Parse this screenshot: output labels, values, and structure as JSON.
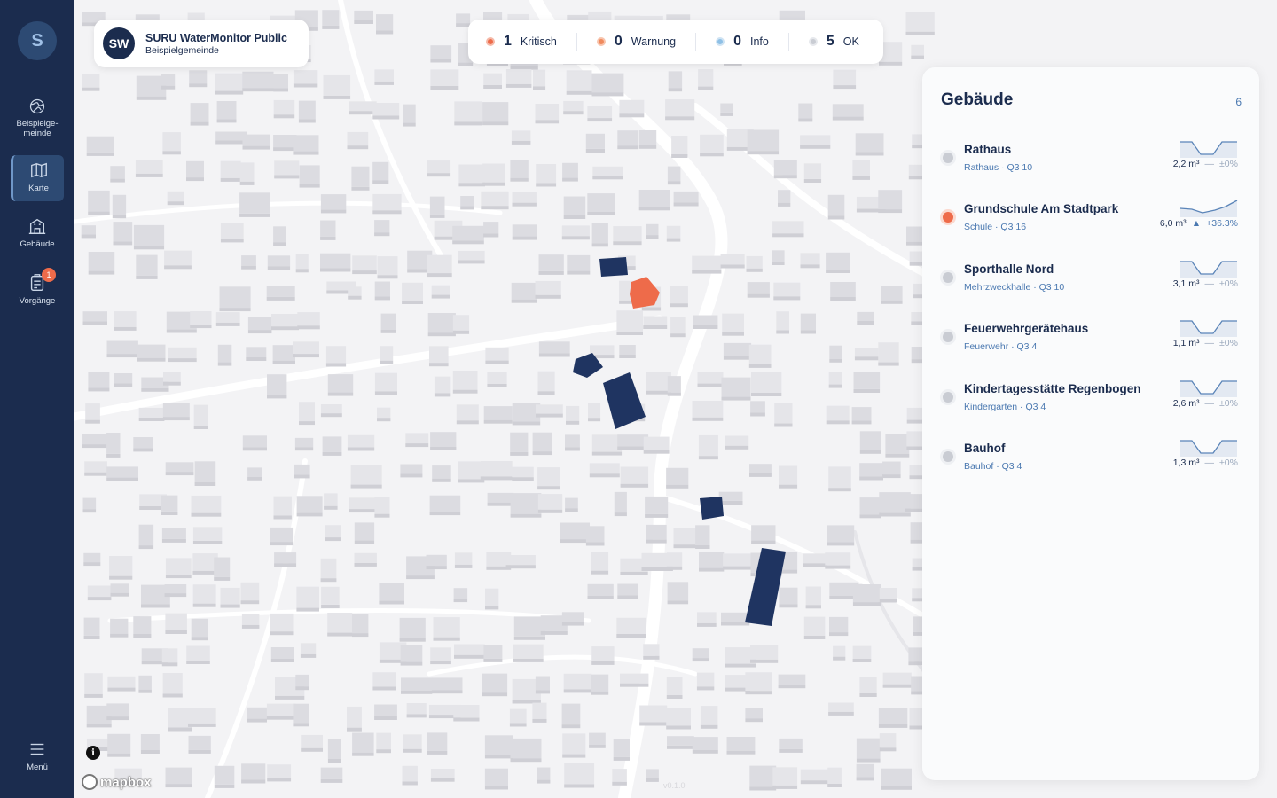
{
  "sidebar": {
    "avatar": "S",
    "items": [
      {
        "label": "Beispielge-\nmeinde",
        "icon": "globe-icon"
      },
      {
        "label": "Karte",
        "icon": "map-icon",
        "active": true
      },
      {
        "label": "Gebäude",
        "icon": "building-icon"
      },
      {
        "label": "Vorgänge",
        "icon": "clipboard-icon",
        "badge": "1"
      }
    ],
    "menu_label": "Menü"
  },
  "brand": {
    "logo": "SW",
    "title": "SURU WaterMonitor Public",
    "subtitle": "Beispielgemeinde"
  },
  "status": [
    {
      "count": "1",
      "label": "Kritisch",
      "color": "#ee6b4a"
    },
    {
      "count": "0",
      "label": "Warnung",
      "color": "#f08a5d"
    },
    {
      "count": "0",
      "label": "Info",
      "color": "#8ec0e6"
    },
    {
      "count": "5",
      "label": "OK",
      "color": "#c9ccd3"
    }
  ],
  "panel": {
    "title": "Gebäude",
    "count": "6",
    "buildings": [
      {
        "name": "Rathaus",
        "sub": "Rathaus · Q3 10",
        "volume": "2,2 m³",
        "trend": "—",
        "pct": "±0%",
        "status": "ok",
        "spark": "dip"
      },
      {
        "name": "Grundschule Am Stadtpark",
        "sub": "Schule · Q3 16",
        "volume": "6,0 m³",
        "trend": "▲",
        "pct": "+36.3%",
        "status": "critical",
        "spark": "rise"
      },
      {
        "name": "Sporthalle Nord",
        "sub": "Mehrzweckhalle · Q3 10",
        "volume": "3,1 m³",
        "trend": "—",
        "pct": "±0%",
        "status": "ok",
        "spark": "dip"
      },
      {
        "name": "Feuerwehrgerätehaus",
        "sub": "Feuerwehr · Q3 4",
        "volume": "1,1 m³",
        "trend": "—",
        "pct": "±0%",
        "status": "ok",
        "spark": "dip"
      },
      {
        "name": "Kindertagesstätte Regenbogen",
        "sub": "Kindergarten · Q3 4",
        "volume": "2,6 m³",
        "trend": "—",
        "pct": "±0%",
        "status": "ok",
        "spark": "dip"
      },
      {
        "name": "Bauhof",
        "sub": "Bauhof · Q3 4",
        "volume": "1,3 m³",
        "trend": "—",
        "pct": "±0%",
        "status": "ok",
        "spark": "dip"
      }
    ]
  },
  "map": {
    "attribution": "mapbox",
    "info": "i",
    "version": "v0.1.0"
  },
  "colors": {
    "sidebar": "#1b2c4e",
    "accent": "#4a78b0",
    "critical": "#ee6b4a",
    "ok": "#c9ccd3",
    "highlight_building": "#1f3461"
  }
}
